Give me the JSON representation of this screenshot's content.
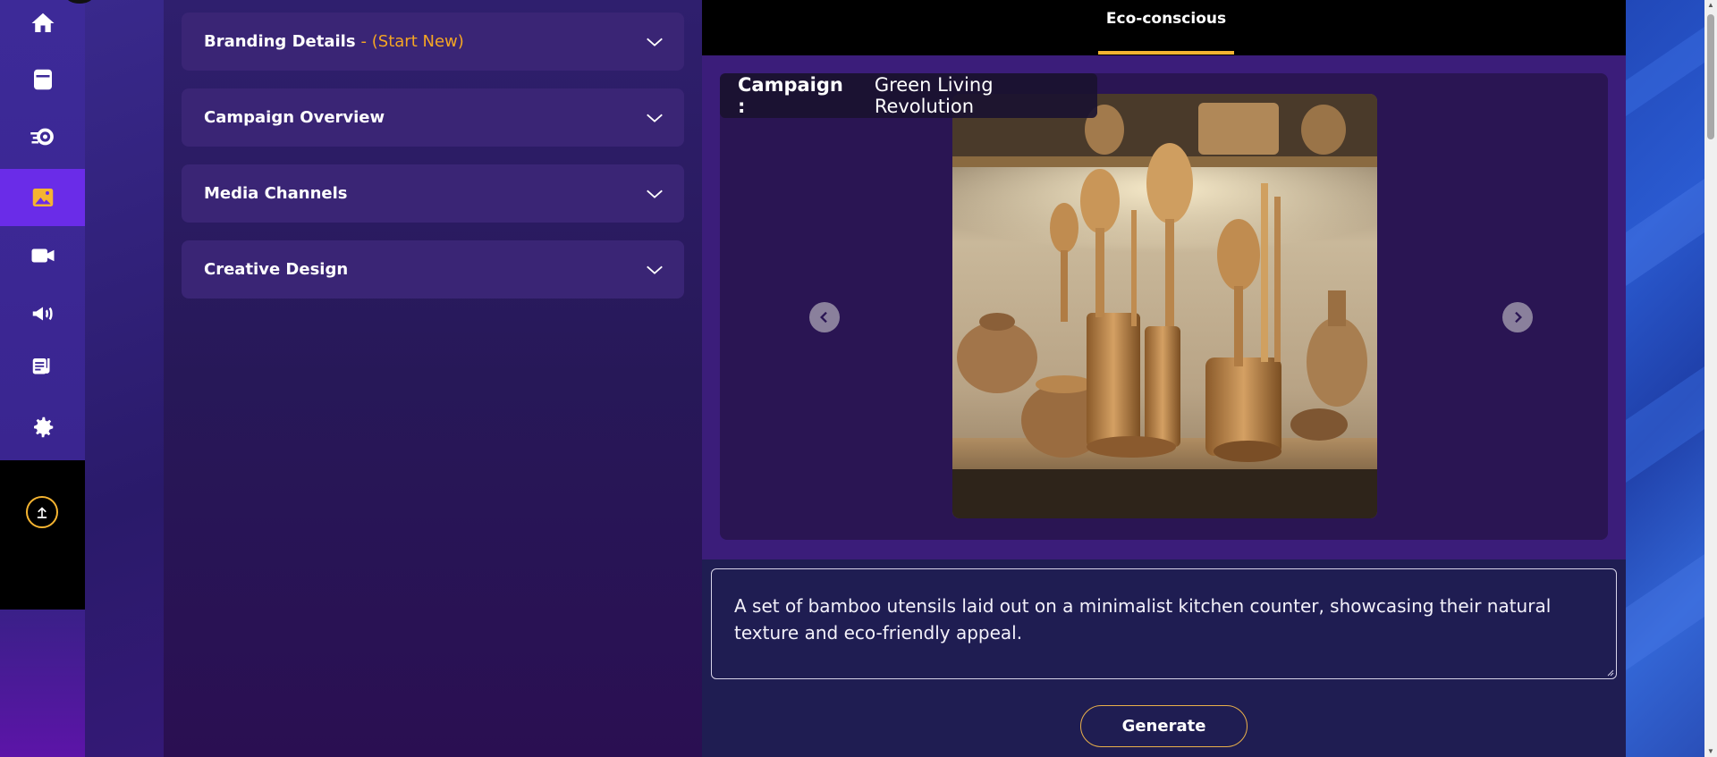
{
  "sidebar": {
    "items": [
      {
        "icon": "home-icon"
      },
      {
        "icon": "book-icon"
      },
      {
        "icon": "settings-sync-icon"
      },
      {
        "icon": "image-icon",
        "active": true
      },
      {
        "icon": "video-camera-icon"
      },
      {
        "icon": "megaphone-icon"
      },
      {
        "icon": "music-note-icon"
      },
      {
        "icon": "gear-icon"
      }
    ],
    "upload_icon": "upload-icon"
  },
  "form": {
    "sections": [
      {
        "title": "Branding Details",
        "suffix": "- (Start New)"
      },
      {
        "title": "Campaign Overview"
      },
      {
        "title": "Media Channels"
      },
      {
        "title": "Creative Design"
      }
    ]
  },
  "main": {
    "active_tab": "Eco-conscious",
    "campaign_label": "Campaign :",
    "campaign_name": "Green Living Revolution",
    "prompt_text": "A set of bamboo utensils laid out on a minimalist kitchen counter, showcasing their natural texture and eco-friendly appeal.",
    "generate_label": "Generate"
  },
  "colors": {
    "accent": "#f5b431",
    "active_nav": "#6a2ce8",
    "panel": "#1f1d52"
  }
}
